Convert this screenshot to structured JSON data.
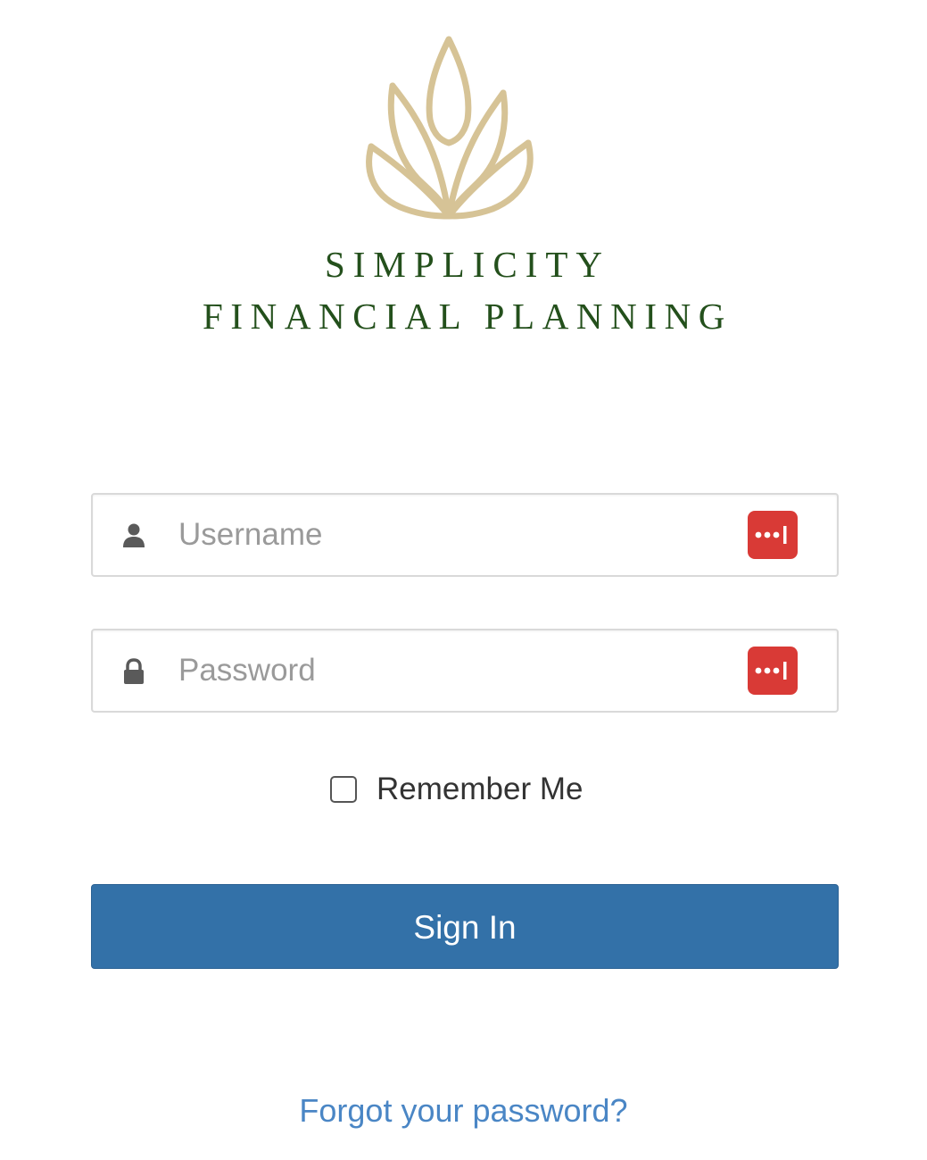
{
  "brand": {
    "logo_icon": "lotus-flame-logo",
    "line1": "SIMPLICITY",
    "line2": "FINANCIAL PLANNING",
    "logo_color": "#d6c396",
    "text_color": "#24501c"
  },
  "login_form": {
    "username": {
      "icon": "user-icon",
      "placeholder": "Username",
      "value": "",
      "password_manager_icon": "password-manager-icon"
    },
    "password": {
      "icon": "lock-icon",
      "placeholder": "Password",
      "value": "",
      "password_manager_icon": "password-manager-icon"
    },
    "remember_me": {
      "label": "Remember Me",
      "checked": false
    },
    "sign_in_label": "Sign In",
    "forgot_password_link": "Forgot your password?"
  },
  "colors": {
    "primary_button": "#3371a8",
    "link": "#4a86c5",
    "password_manager_badge": "#d93a36"
  }
}
